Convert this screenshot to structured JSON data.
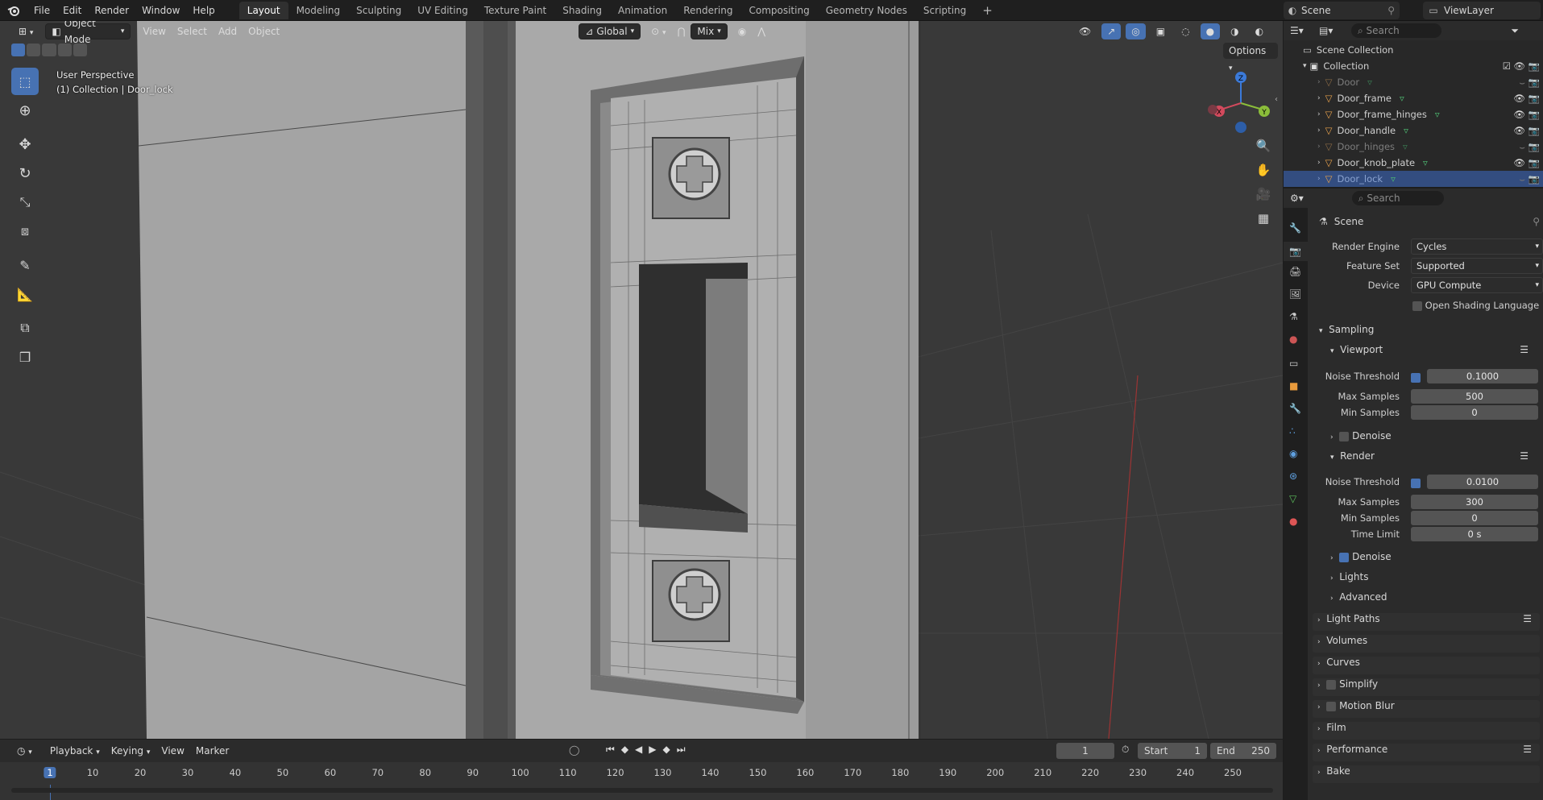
{
  "topbar": {
    "menus": [
      "File",
      "Edit",
      "Render",
      "Window",
      "Help"
    ],
    "workspaces": [
      "Layout",
      "Modeling",
      "Sculpting",
      "UV Editing",
      "Texture Paint",
      "Shading",
      "Animation",
      "Rendering",
      "Compositing",
      "Geometry Nodes",
      "Scripting"
    ],
    "active_workspace": "Layout",
    "add_tab": "+",
    "scene": "Scene",
    "viewlayer": "ViewLayer"
  },
  "viewport": {
    "mode": "Object Mode",
    "menus": [
      "View",
      "Select",
      "Add",
      "Object"
    ],
    "transform_orientation": "Global",
    "snap_mode": "Mix",
    "overlay_title": "User Perspective",
    "overlay_subtitle": "(1) Collection | Door_lock",
    "options": "Options",
    "gizmo": {
      "x": "X",
      "y": "Y",
      "z": "Z"
    }
  },
  "outliner": {
    "search_placeholder": "Search",
    "root": "Scene Collection",
    "collection": "Collection",
    "items": [
      {
        "name": "Door",
        "visible": false
      },
      {
        "name": "Door_frame",
        "visible": true
      },
      {
        "name": "Door_frame_hinges",
        "visible": true
      },
      {
        "name": "Door_handle",
        "visible": true
      },
      {
        "name": "Door_hinges",
        "visible": false
      },
      {
        "name": "Door_knob_plate",
        "visible": true
      },
      {
        "name": "Door_lock",
        "visible": false,
        "selected": true
      }
    ]
  },
  "properties": {
    "search_placeholder": "Search",
    "context": "Scene",
    "render_engine_label": "Render Engine",
    "render_engine": "Cycles",
    "feature_set_label": "Feature Set",
    "feature_set": "Supported",
    "device_label": "Device",
    "device": "GPU Compute",
    "osl_label": "Open Shading Language",
    "sampling": "Sampling",
    "viewport_section": "Viewport",
    "noise_threshold_label": "Noise Threshold",
    "vp_noise_threshold": "0.1000",
    "max_samples_label": "Max Samples",
    "vp_max_samples": "500",
    "min_samples_label": "Min Samples",
    "vp_min_samples": "0",
    "denoise_label": "Denoise",
    "render_section": "Render",
    "r_noise_threshold": "0.0100",
    "r_max_samples": "300",
    "r_min_samples": "0",
    "time_limit_label": "Time Limit",
    "r_time_limit": "0 s",
    "lights": "Lights",
    "advanced": "Advanced",
    "light_paths": "Light Paths",
    "volumes": "Volumes",
    "curves": "Curves",
    "simplify": "Simplify",
    "motion_blur": "Motion Blur",
    "film": "Film",
    "performance": "Performance",
    "bake": "Bake"
  },
  "timeline": {
    "menus": [
      "Playback",
      "Keying",
      "View",
      "Marker"
    ],
    "current_frame": "1",
    "start_label": "Start",
    "start": "1",
    "end_label": "End",
    "end": "250",
    "ticks": [
      "1",
      "10",
      "20",
      "30",
      "40",
      "50",
      "60",
      "70",
      "80",
      "90",
      "100",
      "110",
      "120",
      "130",
      "140",
      "150",
      "160",
      "170",
      "180",
      "190",
      "200",
      "210",
      "220",
      "230",
      "240",
      "250"
    ]
  },
  "colors": {
    "accent": "#4772b3",
    "selection": "#334d80",
    "header": "#1f1f1f",
    "panel": "#2b2b2b",
    "viewport": "#393939"
  }
}
